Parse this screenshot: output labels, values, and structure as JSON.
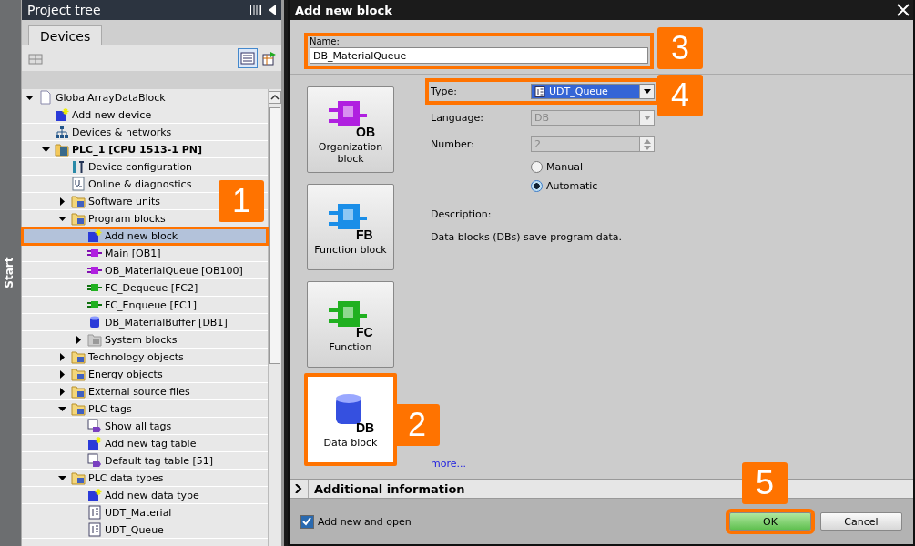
{
  "side_strip": {
    "label": "Start"
  },
  "project_tree": {
    "title": "Project tree",
    "tabs": [
      {
        "label": "Devices",
        "selected": true
      }
    ],
    "items": [
      {
        "label": "GlobalArrayDataBlock",
        "kind": "document",
        "selected": false,
        "expanded": true,
        "children": [
          {
            "label": "Add new device",
            "kind": "add",
            "selected": false
          },
          {
            "label": "Devices & networks",
            "kind": "network",
            "selected": false
          },
          {
            "label": "PLC_1 [CPU 1513-1 PN]",
            "kind": "plc",
            "selected": false,
            "expanded": true,
            "children": [
              {
                "label": "Device configuration",
                "kind": "config",
                "selected": false
              },
              {
                "label": "Online & diagnostics",
                "kind": "diagnostics",
                "selected": false
              },
              {
                "label": "Software units",
                "kind": "folder",
                "selected": false,
                "expanded": false
              },
              {
                "label": "Program blocks",
                "kind": "folder",
                "selected": false,
                "expanded": true,
                "children": [
                  {
                    "label": "Add new block",
                    "kind": "add",
                    "selected": true,
                    "highlighted": true
                  },
                  {
                    "label": "Main [OB1]",
                    "kind": "org",
                    "selected": false
                  },
                  {
                    "label": "OB_MaterialQueue [OB100]",
                    "kind": "org",
                    "selected": false
                  },
                  {
                    "label": "FC_Dequeue [FC2]",
                    "kind": "func",
                    "selected": false
                  },
                  {
                    "label": "FC_Enqueue [FC1]",
                    "kind": "func",
                    "selected": false
                  },
                  {
                    "label": "DB_MaterialBuffer [DB1]",
                    "kind": "cylinder",
                    "selected": false
                  },
                  {
                    "label": "System blocks",
                    "kind": "system",
                    "selected": false,
                    "expanded": false
                  }
                ]
              },
              {
                "label": "Technology objects",
                "kind": "folder",
                "selected": false,
                "expanded": false
              },
              {
                "label": "Energy objects",
                "kind": "folder",
                "selected": false,
                "expanded": false
              },
              {
                "label": "External source files",
                "kind": "folder",
                "selected": false,
                "expanded": false
              },
              {
                "label": "PLC tags",
                "kind": "folder",
                "selected": false,
                "expanded": true,
                "children": [
                  {
                    "label": "Show all tags",
                    "kind": "tags",
                    "selected": false
                  },
                  {
                    "label": "Add new tag table",
                    "kind": "add",
                    "selected": false
                  },
                  {
                    "label": "Default tag table [51]",
                    "kind": "tags",
                    "selected": false
                  }
                ]
              },
              {
                "label": "PLC data types",
                "kind": "folder",
                "selected": false,
                "expanded": true,
                "children": [
                  {
                    "label": "Add new data type",
                    "kind": "add",
                    "selected": false
                  },
                  {
                    "label": "UDT_Material",
                    "kind": "structure",
                    "selected": false
                  },
                  {
                    "label": "UDT_Queue",
                    "kind": "structure",
                    "selected": false
                  }
                ]
              }
            ]
          }
        ]
      }
    ]
  },
  "dialog": {
    "title": "Add new block",
    "name": {
      "label": "Name:",
      "value": "DB_MaterialQueue",
      "highlighted": true
    },
    "block_types": [
      {
        "kind": "org",
        "tag": "OB",
        "label": "Organization block",
        "selected": false,
        "highlighted": false
      },
      {
        "kind": "fbk",
        "tag": "FB",
        "label": "Function block",
        "selected": false,
        "highlighted": false
      },
      {
        "kind": "fcn",
        "tag": "FC",
        "label": "Function",
        "selected": false,
        "highlighted": false
      },
      {
        "kind": "cylinder",
        "tag": "DB",
        "label": "Data block",
        "selected": true,
        "highlighted": true
      }
    ],
    "type": {
      "label": "Type:",
      "value": "UDT_Queue",
      "highlighted": true
    },
    "language": {
      "label": "Language:",
      "value": "DB",
      "disabled": true
    },
    "number": {
      "label": "Number:",
      "value": "2",
      "disabled": true
    },
    "numbering": [
      {
        "label": "Manual",
        "selected": false
      },
      {
        "label": "Automatic",
        "selected": true
      }
    ],
    "description_label": "Description:",
    "description": "Data blocks (DBs) save program data.",
    "more_link": "more...",
    "additional_info": {
      "label": "Additional information",
      "expanded": false
    },
    "add_and_open": {
      "label": "Add new and open",
      "checked": true
    },
    "buttons": [
      {
        "kind": "ok",
        "label": "OK",
        "highlighted": true
      },
      {
        "kind": "cancel",
        "label": "Cancel",
        "highlighted": false
      }
    ]
  },
  "callouts": [
    {
      "number": "1"
    },
    {
      "number": "2"
    },
    {
      "number": "3"
    },
    {
      "number": "4"
    },
    {
      "number": "5"
    }
  ]
}
